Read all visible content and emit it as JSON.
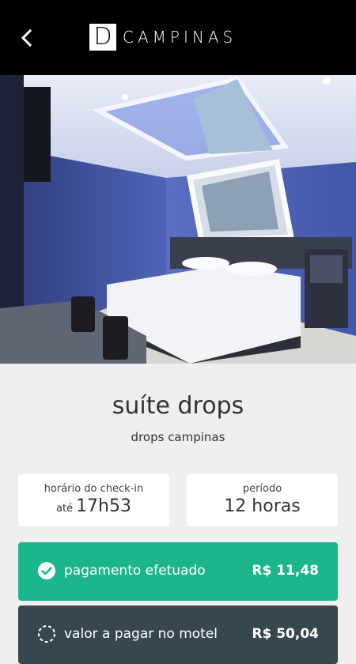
{
  "header": {
    "logo_letter": "D",
    "logo_text": "CAMPINAS",
    "back_icon": "chevron-left-icon"
  },
  "suite": {
    "title": "suíte drops",
    "subtitle": "drops campinas"
  },
  "cards": {
    "checkin": {
      "label": "horário do check-in",
      "prefix": "até",
      "value": "17h53"
    },
    "period": {
      "label": "período",
      "value": "12 horas"
    }
  },
  "payments": {
    "paid": {
      "label": "pagamento efetuado",
      "amount": "R$ 11,48",
      "icon": "check-circle-icon"
    },
    "due": {
      "label": "valor a pagar no motel",
      "amount": "R$ 50,04",
      "icon": "dashed-circle-icon"
    }
  },
  "colors": {
    "header_bg": "#000000",
    "paid_bg": "#1db58e",
    "due_bg": "#37474f",
    "page_bg": "#efefef"
  }
}
